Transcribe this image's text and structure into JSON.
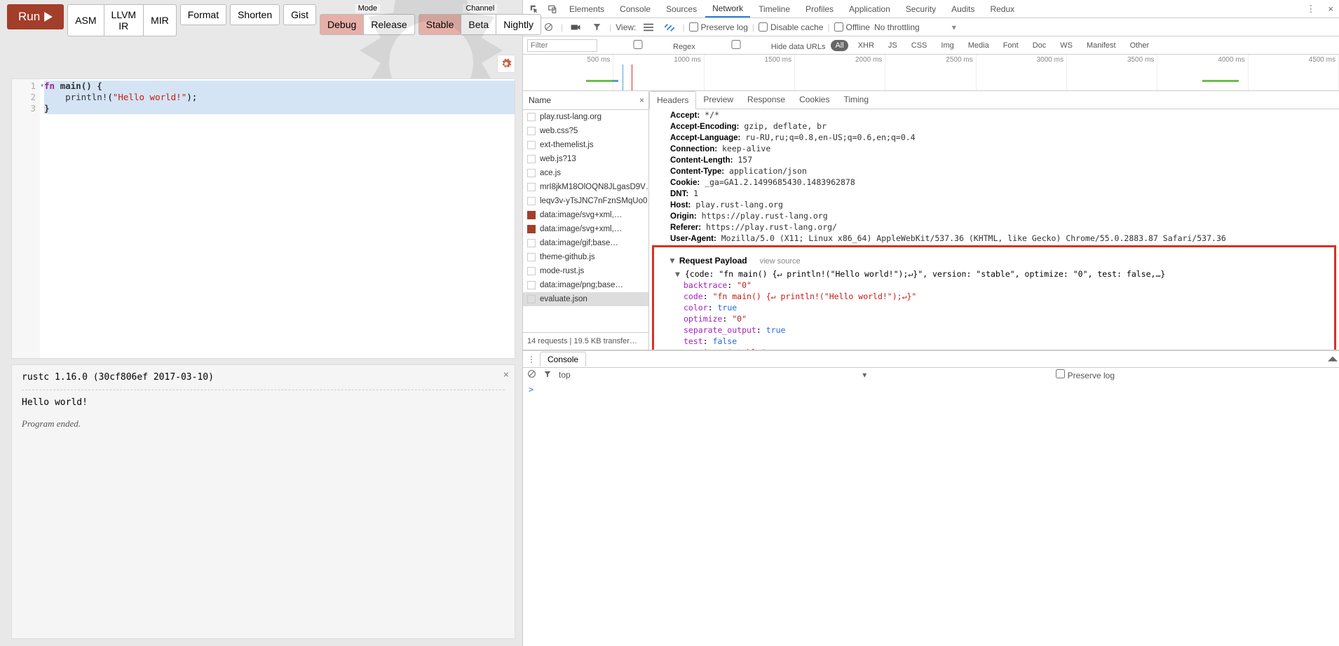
{
  "toolbar": {
    "run": "Run",
    "emit": [
      "ASM",
      "LLVM IR",
      "MIR"
    ],
    "actions": [
      "Format",
      "Shorten",
      "Gist"
    ],
    "mode_label": "Mode",
    "modes": [
      "Debug",
      "Release"
    ],
    "channel_label": "Channel",
    "channels": [
      "Stable",
      "Beta",
      "Nightly"
    ]
  },
  "editor": {
    "lines": [
      "1",
      "2",
      "3"
    ],
    "code": {
      "l1_kw": "fn",
      "l1_name": " main() {",
      "l2_indent": "    ",
      "l2_mac": "println!",
      "l2_open": "(",
      "l2_str": "\"Hello world!\"",
      "l2_close": ");",
      "l3": "}"
    }
  },
  "output": {
    "version": "rustc 1.16.0 (30cf806ef 2017-03-10)",
    "text": "Hello world!",
    "ended": "Program ended."
  },
  "devtools": {
    "tabs": [
      "Elements",
      "Console",
      "Sources",
      "Network",
      "Timeline",
      "Profiles",
      "Application",
      "Security",
      "Audits",
      "Redux"
    ],
    "active_tab": "Network",
    "net_toolbar": {
      "view": "View:",
      "preserve": "Preserve log",
      "disable_cache": "Disable cache",
      "offline": "Offline",
      "throttling": "No throttling"
    },
    "filter": {
      "placeholder": "Filter",
      "regex": "Regex",
      "hide": "Hide data URLs",
      "types": [
        "All",
        "XHR",
        "JS",
        "CSS",
        "Img",
        "Media",
        "Font",
        "Doc",
        "WS",
        "Manifest",
        "Other"
      ]
    },
    "timeline_ticks": [
      "500 ms",
      "1000 ms",
      "1500 ms",
      "2000 ms",
      "2500 ms",
      "3000 ms",
      "3500 ms",
      "4000 ms",
      "4500 ms"
    ],
    "req_header": "Name",
    "requests": [
      "play.rust-lang.org",
      "web.css?5",
      "ext-themelist.js",
      "web.js?13",
      "ace.js",
      "mrI8jkM18OlOQN8JLgasD9V…",
      "leqv3v-yTsJNC7nFznSMqUo0…",
      "data:image/svg+xml,…",
      "data:image/svg+xml,…",
      "data:image/gif;base…",
      "theme-github.js",
      "mode-rust.js",
      "data:image/png;base…",
      "evaluate.json"
    ],
    "req_footer": "14 requests   |   19.5 KB transfer…",
    "detail_tabs": [
      "Headers",
      "Preview",
      "Response",
      "Cookies",
      "Timing"
    ],
    "headers": [
      {
        "k": "Accept:",
        "v": "*/*"
      },
      {
        "k": "Accept-Encoding:",
        "v": "gzip, deflate, br"
      },
      {
        "k": "Accept-Language:",
        "v": "ru-RU,ru;q=0.8,en-US;q=0.6,en;q=0.4"
      },
      {
        "k": "Connection:",
        "v": "keep-alive"
      },
      {
        "k": "Content-Length:",
        "v": "157"
      },
      {
        "k": "Content-Type:",
        "v": "application/json"
      },
      {
        "k": "Cookie:",
        "v": "_ga=GA1.2.1499685430.1483962878"
      },
      {
        "k": "DNT:",
        "v": "1"
      },
      {
        "k": "Host:",
        "v": "play.rust-lang.org"
      },
      {
        "k": "Origin:",
        "v": "https://play.rust-lang.org"
      },
      {
        "k": "Referer:",
        "v": "https://play.rust-lang.org/"
      },
      {
        "k": "User-Agent:",
        "v": "Mozilla/5.0 (X11; Linux x86_64) AppleWebKit/537.36 (KHTML, like Gecko) Chrome/55.0.2883.87 Safari/537.36"
      }
    ],
    "payload_title": "Request Payload",
    "view_source": "view source",
    "payload_summary": "{code: \"fn main() {↵ println!(\"Hello world!\");↵}\", version: \"stable\", optimize: \"0\", test: false,…}",
    "payload": [
      {
        "k": "backtrace",
        "v": "\"0\"",
        "t": "str"
      },
      {
        "k": "code",
        "v": "\"fn main() {↵    println!(\"Hello world!\");↵}\"",
        "t": "str"
      },
      {
        "k": "color",
        "v": "true",
        "t": "plain"
      },
      {
        "k": "optimize",
        "v": "\"0\"",
        "t": "str"
      },
      {
        "k": "separate_output",
        "v": "true",
        "t": "plain"
      },
      {
        "k": "test",
        "v": "false",
        "t": "plain"
      },
      {
        "k": "version",
        "v": "\"stable\"",
        "t": "str"
      }
    ],
    "console_tab": "Console",
    "console_top": "top",
    "console_preserve": "Preserve log",
    "console_prompt": ">"
  }
}
